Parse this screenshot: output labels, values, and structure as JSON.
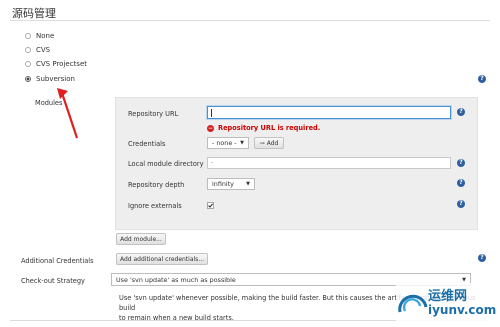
{
  "section_title": "源码管理",
  "scm_options": [
    {
      "label": "None",
      "checked": false
    },
    {
      "label": "CVS",
      "checked": false
    },
    {
      "label": "CVS Projectset",
      "checked": false
    },
    {
      "label": "Subversion",
      "checked": true
    }
  ],
  "modules_label": "Modules",
  "module": {
    "repository_url_label": "Repository URL",
    "repository_url_value": "",
    "repository_url_error": "Repository URL is required.",
    "credentials_label": "Credentials",
    "credentials_value": "- none -",
    "add_button_label": "Add",
    "local_dir_label": "Local module directory",
    "local_dir_value": ".",
    "depth_label": "Repository depth",
    "depth_value": "infinity",
    "ignore_externals_label": "Ignore externals",
    "ignore_externals_checked": true
  },
  "add_module_button": "Add module...",
  "additional_credentials_label": "Additional Credentials",
  "add_additional_credentials_button": "Add additional credentials...",
  "checkout_strategy_label": "Check-out Strategy",
  "checkout_strategy_value": "Use 'svn update' as much as possible",
  "checkout_strategy_desc_line1": "Use 'svn update' whenever possible, making the build faster. But this causes the artifacts from the previous build",
  "checkout_strategy_desc_line2": "to remain when a new build starts.",
  "watermark": {
    "cn": "运维网",
    "url": "iyunv.com"
  },
  "colors": {
    "accent": "#4a90d9",
    "error": "#cc0000",
    "help": "#2f5f9e",
    "arrow": "#e02020"
  }
}
